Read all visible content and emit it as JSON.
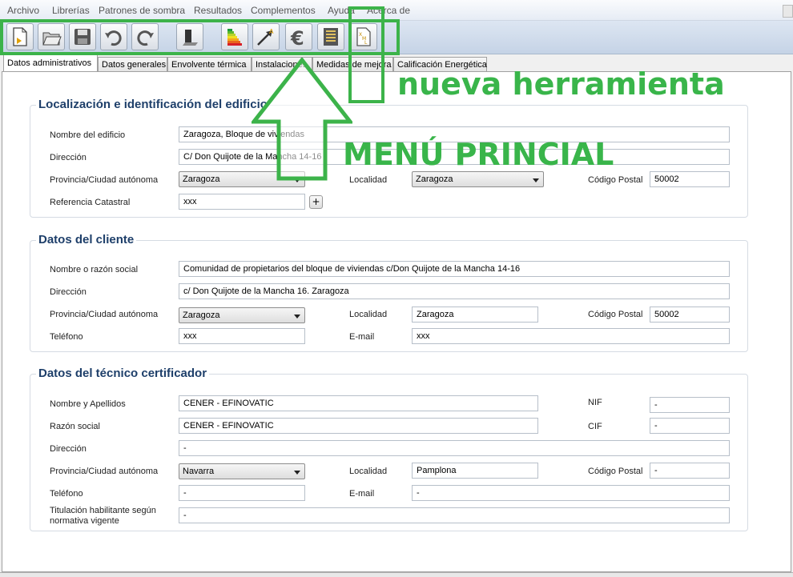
{
  "menu": [
    "Archivo",
    "Librerías",
    "Patrones de sombra",
    "Resultados",
    "Complementos",
    "Ayuda",
    "Acerca de"
  ],
  "toolbar": {
    "icons": [
      "new-file-icon",
      "open-folder-icon",
      "save-icon",
      "undo-icon",
      "redo-icon",
      "building-icon",
      "energy-rating-icon",
      "arrow-a-icon",
      "euro-icon",
      "report-icon",
      "xml-file-icon"
    ]
  },
  "tabs": [
    "Datos administrativos",
    "Datos generales",
    "Envolvente térmica",
    "Instalaciones",
    "Medidas de mejora",
    "Calificación Energética"
  ],
  "section_building": {
    "title": "Localización e identificación del edificio",
    "labels": {
      "name": "Nombre del edificio",
      "address": "Dirección",
      "province": "Provincia/Ciudad autónoma",
      "locality": "Localidad",
      "postal": "Código Postal",
      "cadastral": "Referencia Catastral"
    },
    "values": {
      "name": "Zaragoza, Bloque de viviendas",
      "address": "C/ Don Quijote de la Mancha 14-16",
      "province": "Zaragoza",
      "locality": "Zaragoza",
      "postal": "50002",
      "cadastral": "xxx",
      "plus": "+"
    }
  },
  "section_client": {
    "title": "Datos del cliente",
    "labels": {
      "name": "Nombre o razón social",
      "address": "Dirección",
      "province": "Provincia/Ciudad autónoma",
      "locality": "Localidad",
      "postal": "Código Postal",
      "phone": "Teléfono",
      "email": "E-mail"
    },
    "values": {
      "name": "Comunidad de propietarios del bloque de viviendas c/Don Quijote de la Mancha 14-16",
      "address": "c/ Don Quijote de la Mancha 16. Zaragoza",
      "province": "Zaragoza",
      "locality": "Zaragoza",
      "postal": "50002",
      "phone": "xxx",
      "email": "xxx"
    }
  },
  "section_tech": {
    "title": "Datos del técnico certificador",
    "labels": {
      "name": "Nombre y Apellidos",
      "nif": "NIF",
      "company": "Razón social",
      "cif": "CIF",
      "address": "Dirección",
      "province": "Provincia/Ciudad autónoma",
      "locality": "Localidad",
      "postal": "Código Postal",
      "phone": "Teléfono",
      "email": "E-mail",
      "degree_1": "Titulación habilitante según",
      "degree_2": "normativa vigente"
    },
    "values": {
      "name": "CENER - EFINOVATIC",
      "nif": "-",
      "company": "CENER - EFINOVATIC",
      "cif": "-",
      "address": "-",
      "province": "Navarra",
      "locality": "Pamplona",
      "postal": "-",
      "phone": "-",
      "email": "-",
      "degree": "-"
    }
  },
  "annotations": {
    "new_tool": "nueva herramienta",
    "main_menu": "MENÚ PRINCIAL",
    "color": "#3cb34a"
  }
}
